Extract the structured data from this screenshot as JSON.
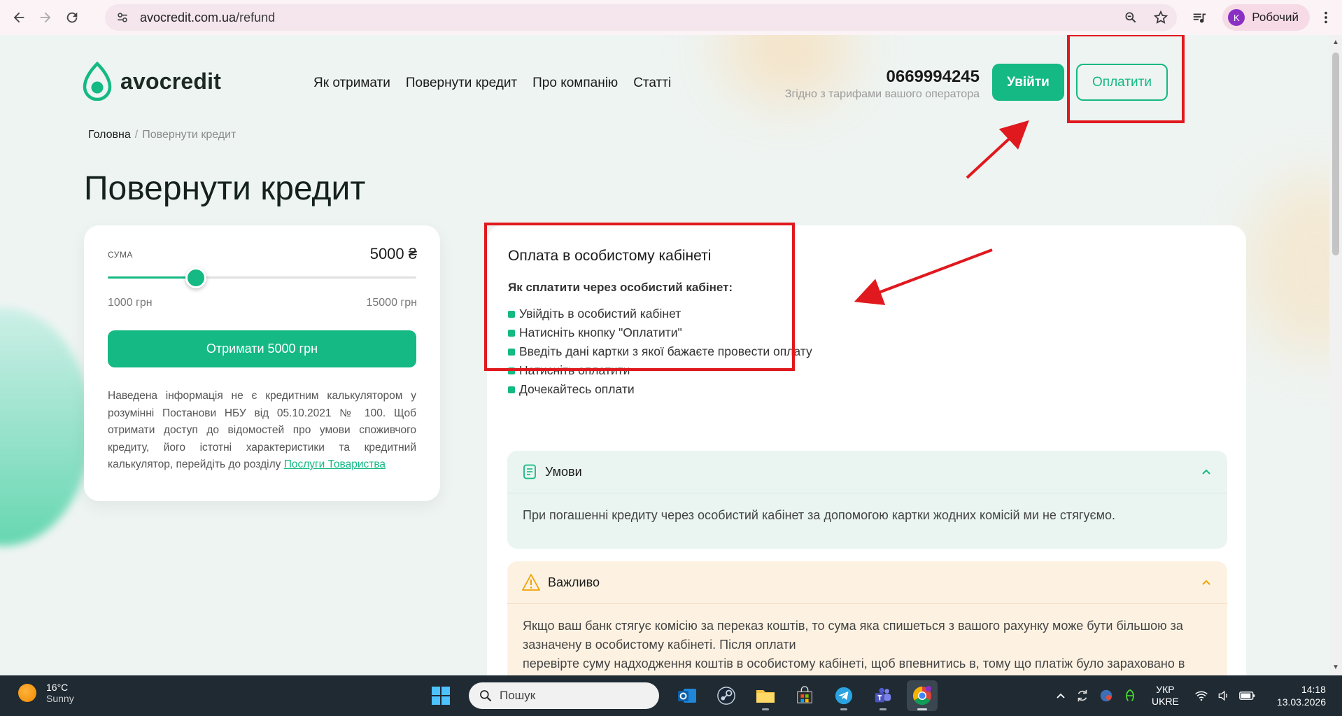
{
  "browser": {
    "url_domain": "avocredit.com.ua",
    "url_path": "/refund",
    "profile_initial": "K",
    "profile_name": "Робочий"
  },
  "header": {
    "logo_text": "avocredit",
    "nav": [
      "Як отримати",
      "Повернути кредит",
      "Про компанію",
      "Статті"
    ],
    "phone": "0669994245",
    "phone_note": "Згідно з тарифами вашого оператора",
    "login_label": "Увійти",
    "pay_label": "Оплатити"
  },
  "breadcrumb": {
    "home": "Головна",
    "separator": "/",
    "current": "Повернути кредит"
  },
  "page_title": "Повернути кредит",
  "calculator": {
    "label": "СУМА",
    "amount": "5000 ₴",
    "slider_min": "1000 грн",
    "slider_max": "15000 грн",
    "slider_value": 5000,
    "slider_range": [
      1000,
      15000
    ],
    "button_label": "Отримати 5000 грн",
    "disclaimer": "Наведена інформація не є кредитним калькулятором у розумінні Постанови НБУ від 05.10.2021 № 100. Щоб отримати доступ до відомостей про умови споживчого кредиту, його істотні характеристики та кредитний калькулятор, перейдіть до розділу ",
    "disclaimer_link": "Послуги Товариства"
  },
  "info": {
    "heading": "Оплата в особистому кабінеті",
    "subheading": "Як сплатити через особистий кабінет:",
    "steps": [
      "Увійдіть в особистий кабінет",
      "Натисніть кнопку \"Оплатити\"",
      "Введіть дані картки з якої бажаєте провести оплату",
      "Натисніть оплатити",
      "Дочекайтесь оплати"
    ],
    "conditions": {
      "title": "Умови",
      "body": "При погашенні кредиту через особистий кабінет за допомогою картки жодних комісій ми не стягуємо."
    },
    "important": {
      "title": "Важливо",
      "body_1": "Якщо ваш банк стягує комісію за переказ коштів, то сума яка спишеться з вашого рахунку може бути більшою за зазначену в особистому кабінеті. Після оплати",
      "body_2": "перевірте суму надходження коштів в особистому кабінеті, щоб впевнитись в, тому що платіж було зараховано в повному обсязі."
    }
  },
  "taskbar": {
    "temperature": "16°C",
    "weather": "Sunny",
    "search_placeholder": "Пошук",
    "lang_1": "УКР",
    "lang_2": "UKRE",
    "time": "14:18",
    "date": "13.03.2026"
  },
  "colors": {
    "brand_green": "#14b983",
    "annotation_red": "#e0191e"
  }
}
